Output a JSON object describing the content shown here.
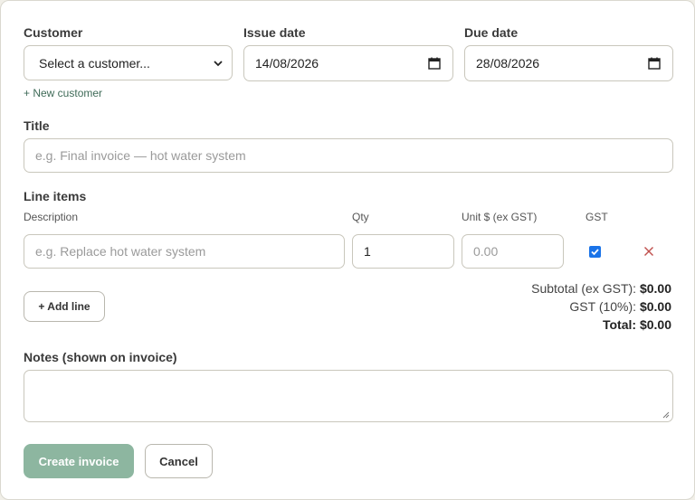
{
  "customer": {
    "label": "Customer",
    "selected": "Select a customer...",
    "new_link": "+ New customer"
  },
  "issue_date": {
    "label": "Issue date",
    "value": "14/08/2026"
  },
  "due_date": {
    "label": "Due date",
    "value": "28/08/2026"
  },
  "title": {
    "label": "Title",
    "placeholder": "e.g. Final invoice — hot water system"
  },
  "line_items": {
    "label": "Line items",
    "columns": {
      "description": "Description",
      "qty": "Qty",
      "unit": "Unit $ (ex GST)",
      "gst": "GST"
    },
    "rows": [
      {
        "description_placeholder": "e.g. Replace hot water system",
        "qty": "1",
        "unit_placeholder": "0.00",
        "gst": true
      }
    ],
    "add_line": "+ Add line"
  },
  "totals": {
    "subtotal_label": "Subtotal (ex GST):",
    "subtotal": "$0.00",
    "gst_label": "GST (10%):",
    "gst": "$0.00",
    "total_label": "Total:",
    "total": "$0.00"
  },
  "notes": {
    "label": "Notes (shown on invoice)",
    "value": ""
  },
  "actions": {
    "create": "Create invoice",
    "cancel": "Cancel"
  },
  "colors": {
    "accent": "#8db6a0",
    "link": "#3f6b58",
    "remove": "#c0504d",
    "checkbox": "#1a73e8"
  },
  "icons": {
    "select": "chevron-down-icon",
    "date": "calendar-icon",
    "remove": "close-icon",
    "check": "check-icon"
  }
}
